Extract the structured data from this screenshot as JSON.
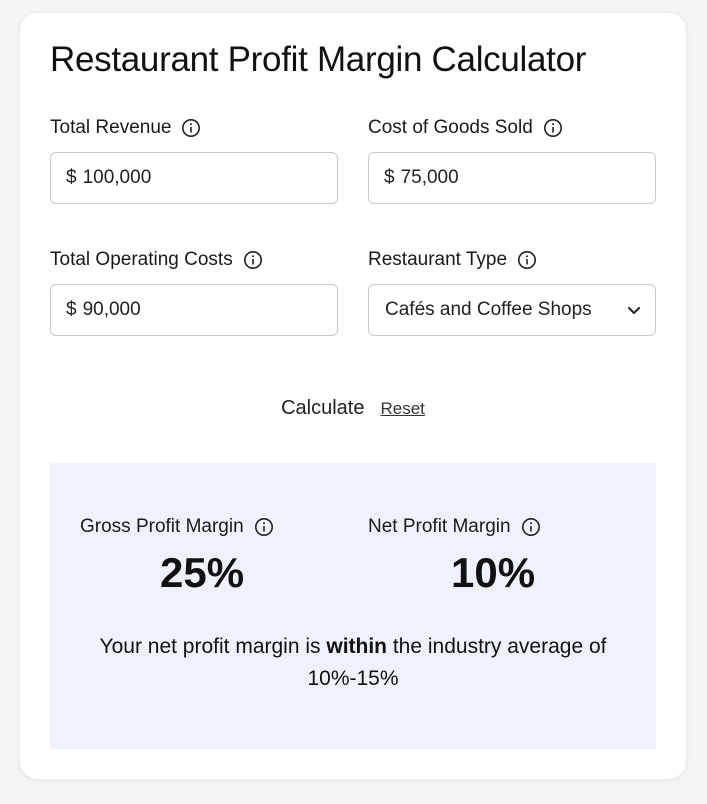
{
  "title": "Restaurant Profit Margin Calculator",
  "fields": {
    "total_revenue": {
      "label": "Total Revenue",
      "currency": "$",
      "value": "100,000"
    },
    "cogs": {
      "label": "Cost of Goods Sold",
      "currency": "$",
      "value": "75,000"
    },
    "operating_costs": {
      "label": "Total Operating Costs",
      "currency": "$",
      "value": "90,000"
    },
    "restaurant_type": {
      "label": "Restaurant Type",
      "selected": "Cafés and Coffee Shops"
    }
  },
  "actions": {
    "calculate_label": "Calculate",
    "reset_label": "Reset"
  },
  "results": {
    "gross": {
      "label": "Gross Profit Margin",
      "value": "25%"
    },
    "net": {
      "label": "Net Profit Margin",
      "value": "10%"
    },
    "summary_prefix": "Your net profit margin is ",
    "summary_emphasis": "within",
    "summary_suffix": " the industry average of 10%-15%",
    "background_color": "#eff2fe"
  },
  "icons": {
    "info": "info-circle-icon",
    "dropdown": "chevron-down-icon"
  }
}
